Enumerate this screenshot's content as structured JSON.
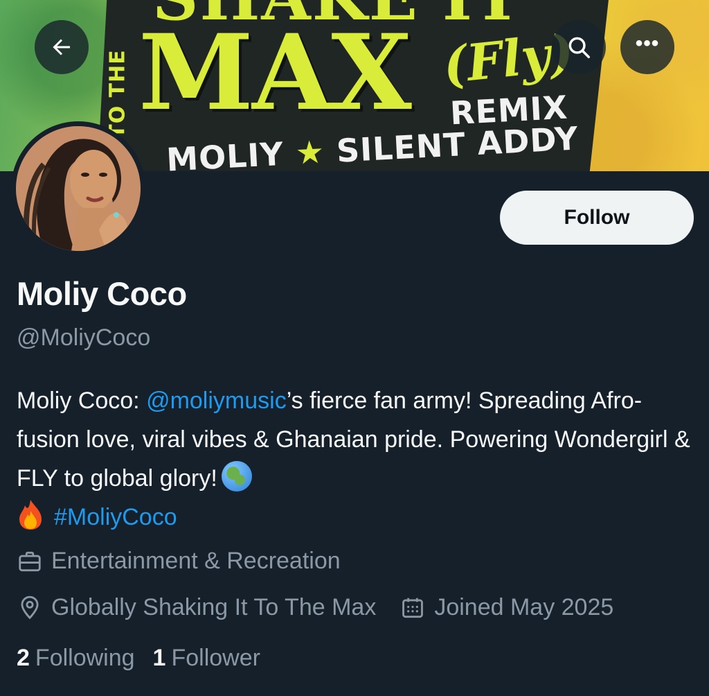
{
  "header": {
    "back_icon": "arrow-left-icon",
    "search_icon": "search-icon",
    "more_icon": "more-horizontal-icon",
    "more_label": "•••"
  },
  "banner": {
    "side_text": "TO THE",
    "top_text": "SHAKE IT",
    "title": "MAX",
    "script": "(Fly)",
    "remix": "REMIX",
    "artist_1": "MOLIY",
    "star": "★",
    "artist_2": "SILENT ADDY"
  },
  "profile": {
    "follow_label": "Follow",
    "display_name": "Moliy Coco",
    "handle": "@MoliyCoco",
    "bio": {
      "prefix": "Moliy Coco: ",
      "mention": "@moliymusic",
      "middle": "’s fierce fan army! Spreading Afro-fusion love, viral vibes & Ghanaian pride. Powering Wondergirl & FLY to global glory!",
      "hashtag": "#MoliyCoco"
    },
    "category": "Entertainment & Recreation",
    "location": "Globally Shaking It To The Max",
    "joined": "Joined May 2025",
    "following_count": "2",
    "following_label": "Following",
    "followers_count": "1",
    "followers_label": "Follower"
  },
  "colors": {
    "background": "#15202b",
    "link": "#1d9bf0",
    "secondary_text": "#8b98a5",
    "follow_bg": "#eff3f4"
  }
}
